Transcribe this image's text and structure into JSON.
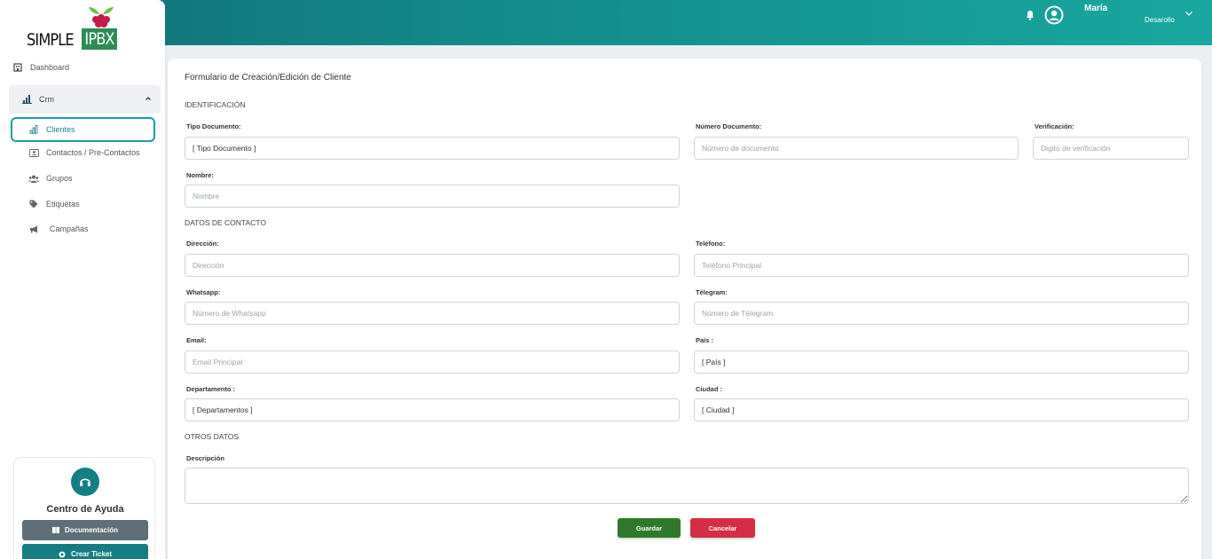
{
  "header": {
    "user_name": "María",
    "user_role": "Desarollo",
    "icons": [
      "bell-icon",
      "user-circle-icon",
      "chevron-down-icon"
    ]
  },
  "logo": {
    "text_simple": "SIMPLE",
    "text_ipbx": "IPBX"
  },
  "sidebar": {
    "items": [
      {
        "label": "Dashboard",
        "icon": "building-icon"
      },
      {
        "label": "Crm",
        "icon": "chart-icon"
      },
      {
        "label": "Clientes",
        "icon": "chart-icon"
      },
      {
        "label": "Contactos / Pre-Contactos",
        "icon": "contact-card-icon"
      },
      {
        "label": "Grupos",
        "icon": "users-icon"
      },
      {
        "label": "Etiquetas",
        "icon": "tag-icon"
      },
      {
        "label": "Campañas",
        "icon": "megaphone-icon"
      }
    ],
    "help": {
      "title": "Centro de Ayuda",
      "doc_label": "Documentación",
      "ticket_label": "Crear Ticket"
    }
  },
  "form": {
    "title": "Formulario de Creación/Edición de Cliente",
    "sections": {
      "identificacion": "IDENTIFICACIÓN",
      "contacto": "DATOS DE CONTACTO",
      "otros": "OTROS DATOS"
    },
    "fields": {
      "tipo_documento": {
        "label": "Tipo Documento:",
        "value": "[ Tipo Documento ]"
      },
      "numero_documento": {
        "label": "Número Documento:",
        "placeholder": "Número de documento"
      },
      "verificacion": {
        "label": "Verificación:",
        "placeholder": "Digito de verificación"
      },
      "nombre": {
        "label": "Nombre:",
        "placeholder": "Nombre"
      },
      "direccion": {
        "label": "Dirección:",
        "placeholder": "Dirección"
      },
      "telefono": {
        "label": "Teléfono:",
        "placeholder": "Teléfono Principal"
      },
      "whatsapp": {
        "label": "Whatsapp:",
        "placeholder": "Número de Whatsapp"
      },
      "telegram": {
        "label": "Télegram:",
        "placeholder": "Número de Télegram"
      },
      "email": {
        "label": "Email:",
        "placeholder": "Email Principal"
      },
      "pais": {
        "label": "País :",
        "value": "[ País ]"
      },
      "departamento": {
        "label": "Departamento :",
        "value": "[ Departamentos ]"
      },
      "ciudad": {
        "label": "Ciudad :",
        "value": "[ Ciudad ]"
      },
      "descripcion": {
        "label": "Descripción",
        "placeholder": ""
      }
    },
    "buttons": {
      "save": "Guardar",
      "cancel": "Cancelar"
    }
  },
  "colors": {
    "accent": "#138a8a",
    "save": "#2f7a2a",
    "cancel": "#d42d45"
  }
}
